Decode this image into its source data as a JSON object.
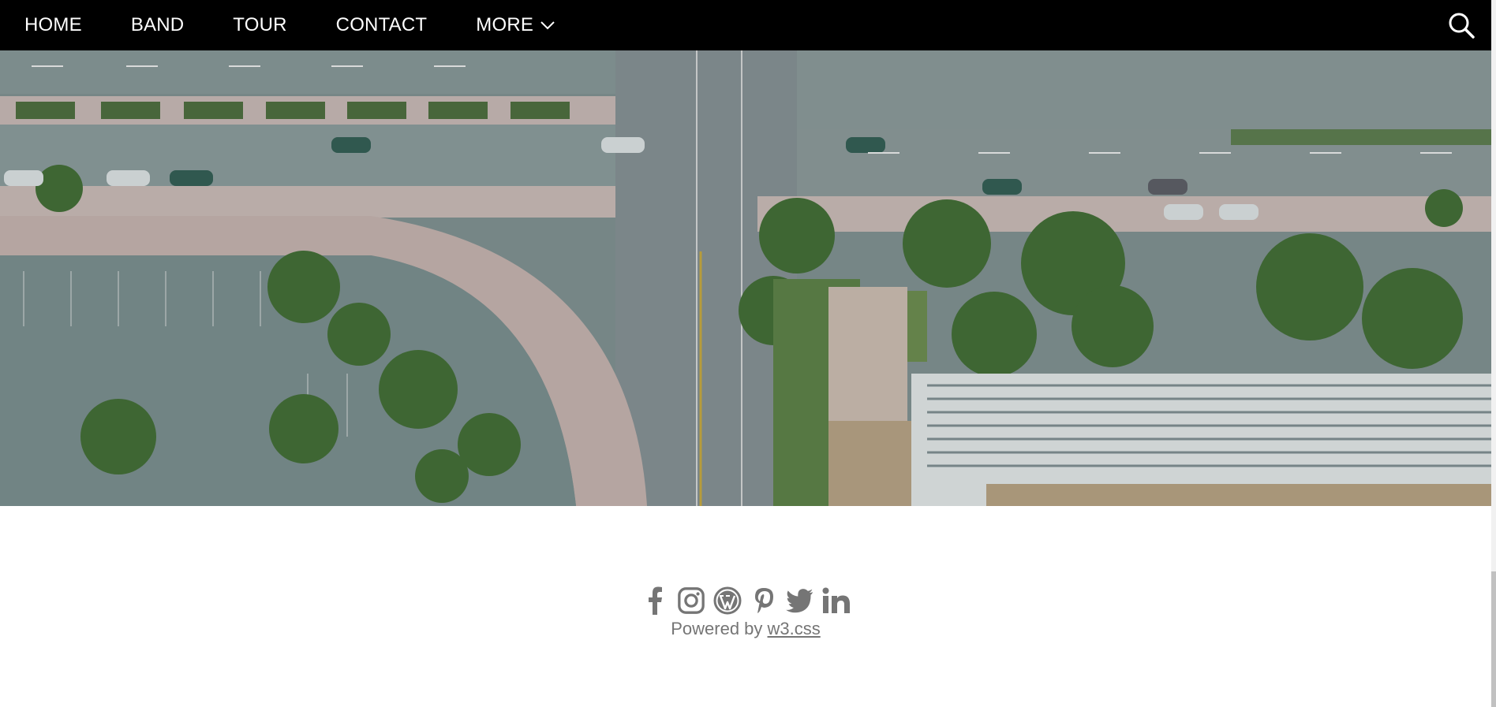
{
  "nav": {
    "items": [
      {
        "label": "HOME"
      },
      {
        "label": "BAND"
      },
      {
        "label": "TOUR"
      },
      {
        "label": "CONTACT"
      }
    ],
    "more_label": "MORE",
    "more_icon": "chevron-down-icon",
    "search_icon": "search-icon"
  },
  "hero": {
    "description": "",
    "image_icon": "aerial-city-photo"
  },
  "footer": {
    "social_icons": [
      "facebook-icon",
      "instagram-icon",
      "wordpress-icon",
      "pinterest-icon",
      "twitter-icon",
      "linkedin-icon"
    ],
    "powered_prefix": "Powered by ",
    "powered_link": "w3.css",
    "text_color": "#757575"
  },
  "colors": {
    "navbar_bg": "#000000",
    "nav_text": "#ffffff",
    "footer_bg": "#ffffff"
  }
}
